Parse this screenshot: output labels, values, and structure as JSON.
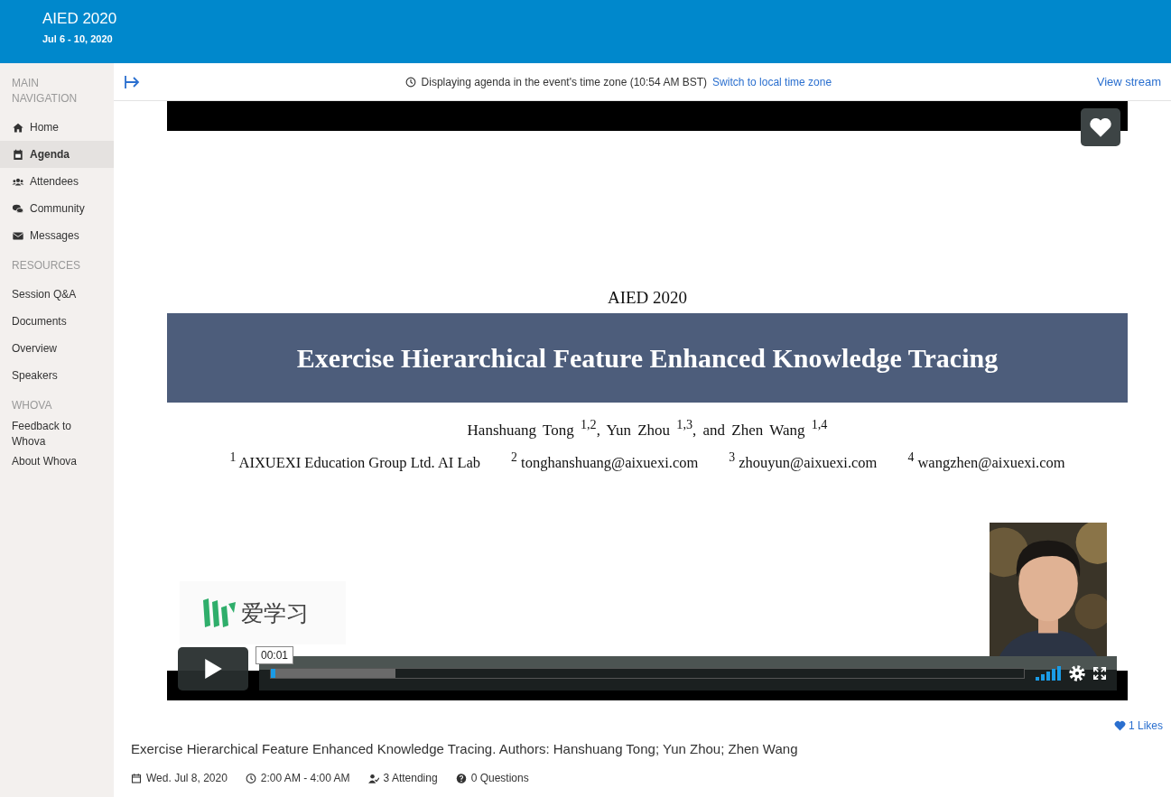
{
  "header": {
    "title": "AIED 2020",
    "dates": "Jul 6 - 10, 2020"
  },
  "sidebar": {
    "sections": [
      {
        "heading": "MAIN NAVIGATION",
        "items": [
          {
            "label": "Home",
            "selected": false
          },
          {
            "label": "Agenda",
            "selected": true
          },
          {
            "label": "Attendees",
            "selected": false
          },
          {
            "label": "Community",
            "selected": false
          },
          {
            "label": "Messages",
            "selected": false
          }
        ]
      },
      {
        "heading": "RESOURCES",
        "items": [
          {
            "label": "Session Q&A",
            "selected": false
          },
          {
            "label": "Documents",
            "selected": false
          },
          {
            "label": "Overview",
            "selected": false
          },
          {
            "label": "Speakers",
            "selected": false
          }
        ]
      },
      {
        "heading": "WHOVA",
        "items": [
          {
            "label": "Feedback to Whova",
            "selected": false
          },
          {
            "label": "About Whova",
            "selected": false
          }
        ]
      }
    ]
  },
  "topbar": {
    "notice": "Displaying agenda in the event's time zone (10:54 AM BST)",
    "switch_link": "Switch to local time zone",
    "view_stream": "View stream"
  },
  "video": {
    "slide": {
      "conference": "AIED 2020",
      "title": "Exercise Hierarchical Feature Enhanced Knowledge Tracing",
      "authors": "Hanshuang Tong $^{1,2}$, Yun Zhou $^{1,3}$, and Zhen Wang $^{1,4}$",
      "affiliations": [
        "$^{1}$ AIXUEXI Education Group Ltd. AI Lab",
        "$^{2}$ tonghanshuang@aixuexi.com",
        "$^{3}$ zhouyun@aixuexi.com",
        "$^{4}$ wangzhen@aixuexi.com"
      ],
      "logo_text": "爱学习"
    },
    "player": {
      "time": "00:01",
      "played": {
        "level": 0.006
      },
      "buffered": {
        "level": 0.166
      }
    }
  },
  "session": {
    "likes": "1 Likes",
    "title": "Exercise Hierarchical Feature Enhanced Knowledge Tracing. Authors: Hanshuang Tong; Yun Zhou; Zhen Wang",
    "meta": [
      "Wed. Jul 8, 2020",
      "2:00 AM - 4:00 AM",
      "3 Attending",
      "0 Questions"
    ]
  }
}
